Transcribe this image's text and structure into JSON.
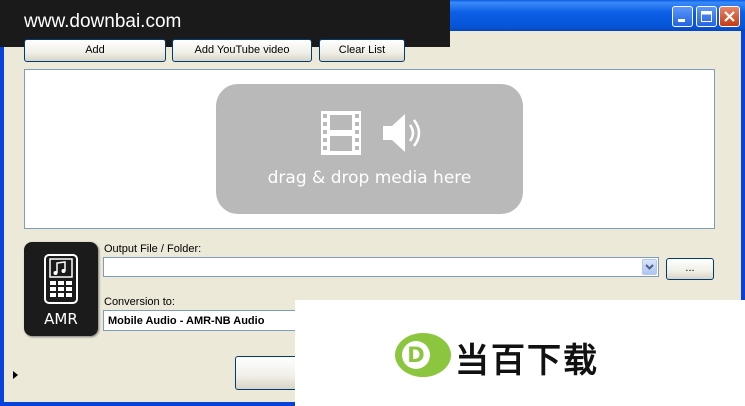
{
  "watermark": {
    "text": "www.downbai.com"
  },
  "toolbar": {
    "add_label": "Add",
    "add_youtube_label": "Add YouTube video",
    "clear_list_label": "Clear List"
  },
  "dropzone": {
    "text": "drag & drop media here",
    "icons": [
      "film-icon",
      "speaker-icon"
    ]
  },
  "format": {
    "label": "AMR",
    "icon": "mobile-phone-music-icon"
  },
  "output": {
    "label": "Output File / Folder:",
    "value": "",
    "browse_label": "..."
  },
  "conversion": {
    "label": "Conversion to:",
    "value": "Mobile Audio - AMR-NB Audio"
  },
  "promo": {
    "logo_letter": "D",
    "text": "当百下载"
  },
  "colors": {
    "titlebar": "#0b5fe6",
    "window_bg": "#ece9d8",
    "drop_card": "#b9b9b9",
    "promo_green": "#8cc63f"
  }
}
